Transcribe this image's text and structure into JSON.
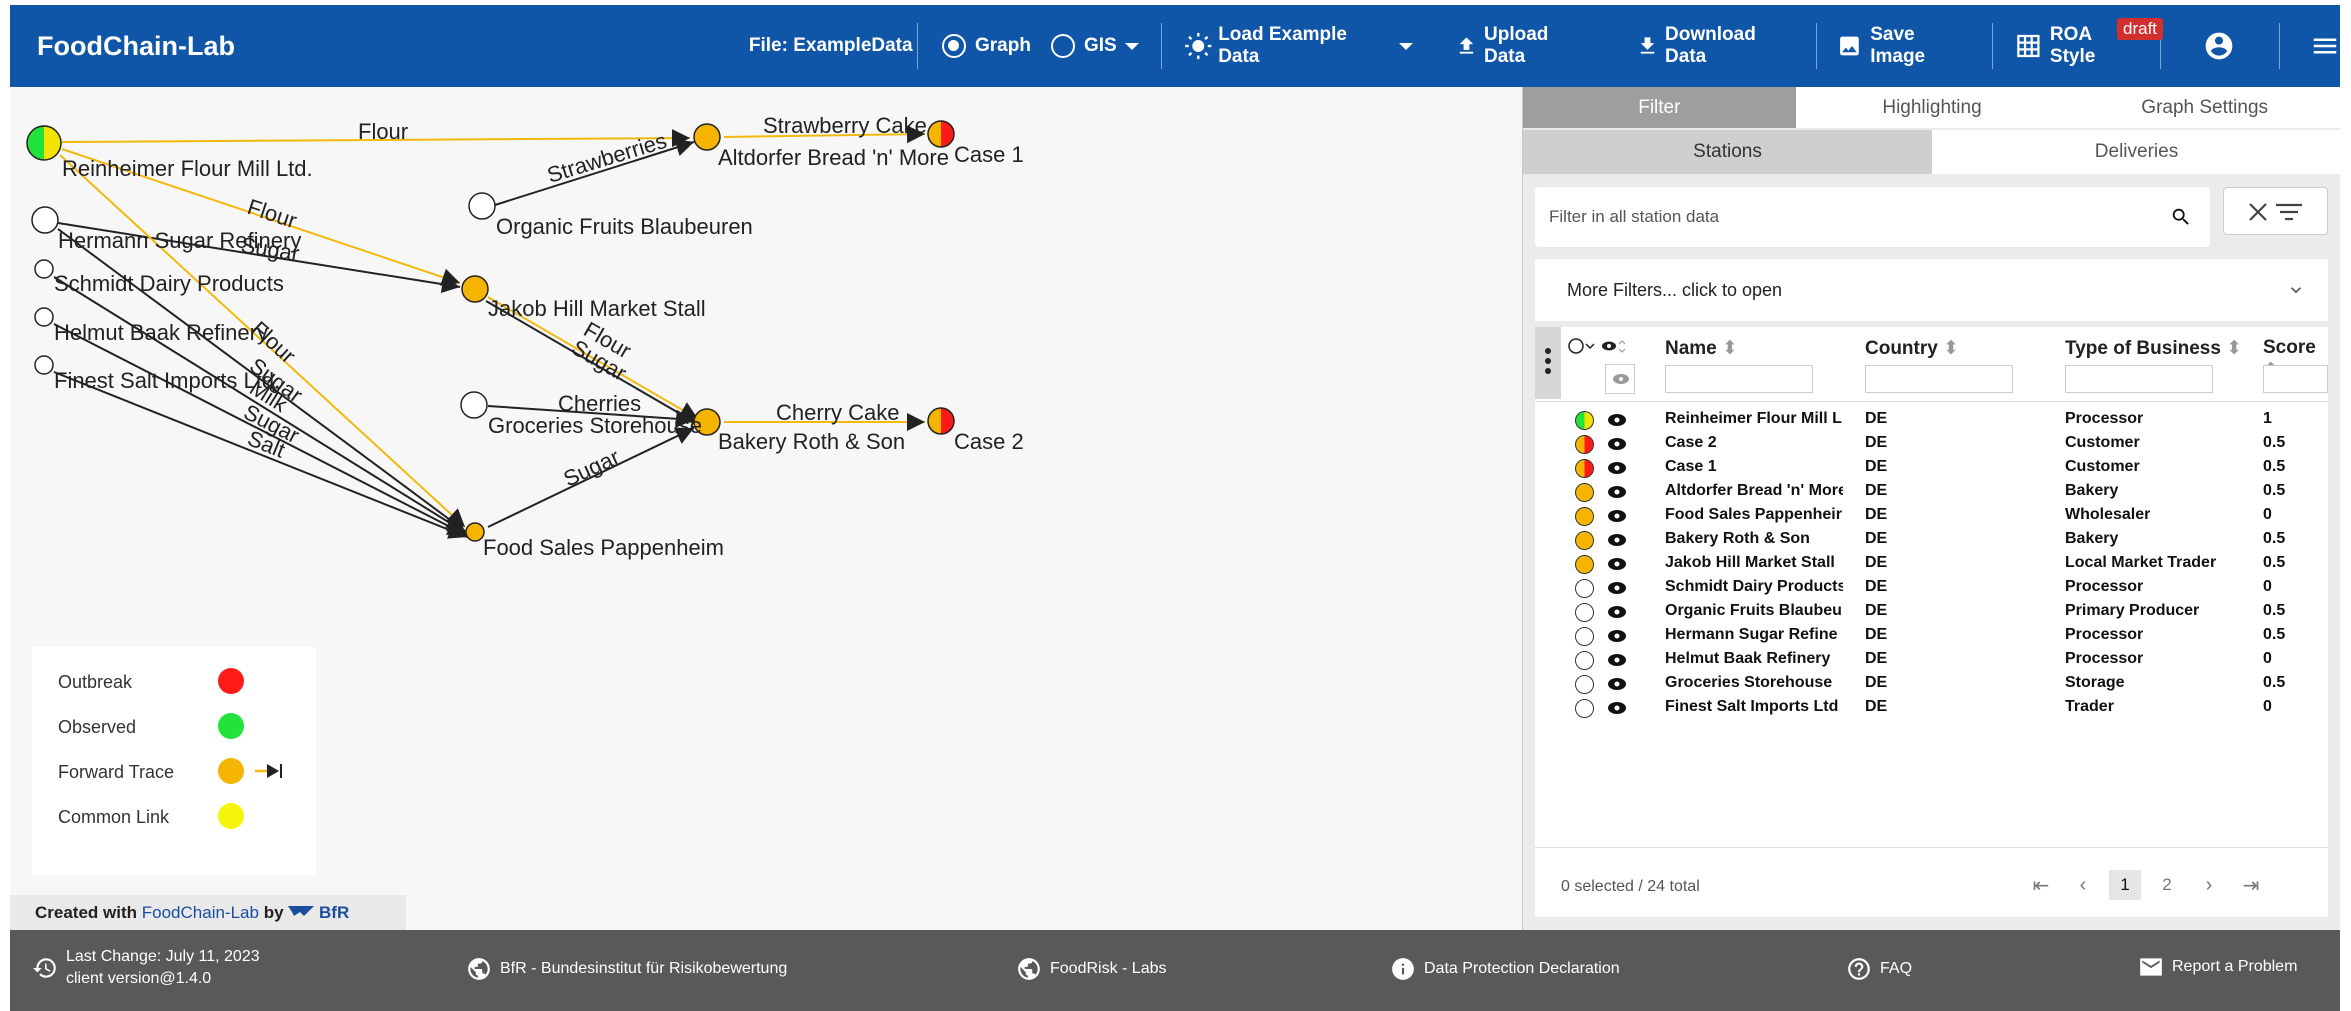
{
  "toolbar": {
    "app_title": "FoodChain-Lab",
    "file_label": "File: ExampleData",
    "view_graph": "Graph",
    "view_gis": "GIS",
    "load_example": "Load Example Data",
    "upload": "Upload Data",
    "download": "Download Data",
    "save_image": "Save Image",
    "roa_style": "ROA Style",
    "draft_badge": "draft",
    "icons": [
      "radio-checked-icon",
      "radio-unchecked-icon",
      "sun-icon",
      "upload-icon",
      "download-icon",
      "image-icon",
      "grid-icon",
      "account-icon",
      "menu-icon"
    ]
  },
  "graph": {
    "nodes": {
      "reinheimer": "Reinheimer Flour Mill Ltd.",
      "hermann": "Hermann Sugar Refinery",
      "schmidt": "Schmidt Dairy Products",
      "helmut": "Helmut Baak Refinery",
      "finest": "Finest Salt Imports Ltd.",
      "organic": "Organic Fruits Blaubeuren",
      "altdorfer": "Altdorfer Bread 'n' More",
      "case1": "Case 1",
      "jakob": "Jakob Hill Market Stall",
      "groceries": "Groceries Storehouse",
      "bakery": "Bakery Roth & Son",
      "case2": "Case 2",
      "foodsales": "Food Sales Pappenheim"
    },
    "edges": {
      "flour1": "Flour",
      "strawberry_cake": "Strawberry Cake",
      "strawberries": "Strawberries",
      "flour2": "Flour",
      "sugar1": "Sugar",
      "flour3": "Flour",
      "flour4": "Flour",
      "sugar2": "Sugar",
      "sugar3": "Sugar",
      "milk": "Milk",
      "sugar4": "Sugar",
      "salt": "Salt",
      "cherries": "Cherries",
      "cherry_cake": "Cherry Cake",
      "sugar5": "Sugar"
    }
  },
  "legend": {
    "items": [
      {
        "label": "Outbreak",
        "color": "#ff1a1a"
      },
      {
        "label": "Observed",
        "color": "#22e33a"
      },
      {
        "label": "Forward Trace",
        "color": "#f5b400"
      },
      {
        "label": "Common Link",
        "color": "#f5f50a"
      }
    ]
  },
  "created_with": {
    "prefix": "Created with",
    "app": "FoodChain-Lab",
    "by": "by",
    "org": "BfR"
  },
  "panel": {
    "tabs": [
      "Filter",
      "Highlighting",
      "Graph Settings"
    ],
    "subtabs": [
      "Stations",
      "Deliveries"
    ],
    "search_placeholder": "Filter in all station data",
    "more_filters": "More Filters... click to open",
    "columns": [
      "Name",
      "Country",
      "Type of Business",
      "Score"
    ],
    "rows": [
      {
        "name": "Reinheimer Flour Mill L",
        "country": "DE",
        "type": "Processor",
        "score": "1",
        "status": "observed"
      },
      {
        "name": "Case 2",
        "country": "DE",
        "type": "Customer",
        "score": "0.5",
        "status": "outbreak"
      },
      {
        "name": "Case 1",
        "country": "DE",
        "type": "Customer",
        "score": "0.5",
        "status": "outbreak"
      },
      {
        "name": "Altdorfer Bread 'n' More",
        "country": "DE",
        "type": "Bakery",
        "score": "0.5",
        "status": "trace"
      },
      {
        "name": "Food Sales Pappenheir",
        "country": "DE",
        "type": "Wholesaler",
        "score": "0",
        "status": "trace"
      },
      {
        "name": "Bakery Roth & Son",
        "country": "DE",
        "type": "Bakery",
        "score": "0.5",
        "status": "trace"
      },
      {
        "name": "Jakob Hill Market Stall",
        "country": "DE",
        "type": "Local Market Trader",
        "score": "0.5",
        "status": "trace"
      },
      {
        "name": "Schmidt Dairy Products",
        "country": "DE",
        "type": "Processor",
        "score": "0",
        "status": "none"
      },
      {
        "name": "Organic Fruits Blaubeu",
        "country": "DE",
        "type": "Primary Producer",
        "score": "0.5",
        "status": "none"
      },
      {
        "name": "Hermann Sugar Refine",
        "country": "DE",
        "type": "Processor",
        "score": "0.5",
        "status": "none"
      },
      {
        "name": "Helmut Baak Refinery",
        "country": "DE",
        "type": "Processor",
        "score": "0",
        "status": "none"
      },
      {
        "name": "Groceries Storehouse",
        "country": "DE",
        "type": "Storage",
        "score": "0.5",
        "status": "none"
      },
      {
        "name": "Finest Salt Imports Ltd",
        "country": "DE",
        "type": "Trader",
        "score": "0",
        "status": "none"
      }
    ],
    "pager_text": "0 selected / 24 total",
    "pages": [
      "1",
      "2"
    ]
  },
  "footer": {
    "last_change": "Last Change: July 11, 2023",
    "client_version": "client version@1.4.0",
    "bfr": "BfR - Bundesinstitut für Risikobewertung",
    "foodrisk": "FoodRisk - Labs",
    "data_protection": "Data Protection Declaration",
    "faq": "FAQ",
    "report": "Report a Problem"
  }
}
